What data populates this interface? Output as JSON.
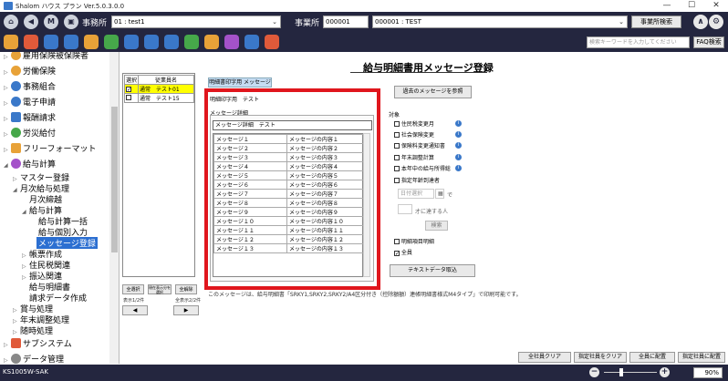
{
  "window": {
    "title": "Shalom ハウス プラン Ver.5.0.3.0.0",
    "min": "—",
    "max": "☐",
    "close": "✕"
  },
  "toolbar1": {
    "office_label": "事務所",
    "office_value": "01 : test1",
    "establishment_label": "事業所",
    "establishment_code": "000001",
    "establishment_value": "000001 : TEST",
    "establishment_search": "事業所検索"
  },
  "toolbar2": {
    "search_placeholder": "検索キーワードを入力してください",
    "faq": "FAQ検索"
  },
  "sidebar": {
    "items": [
      {
        "label": "雇用保険被保険者"
      },
      {
        "label": "労働保険"
      },
      {
        "label": "事務組合"
      },
      {
        "label": "電子申請"
      },
      {
        "label": "報酬請求"
      },
      {
        "label": "労災給付"
      },
      {
        "label": "フリーフォーマット"
      },
      {
        "label": "給与計算"
      },
      {
        "label": "マスター登録"
      },
      {
        "label": "月次給与処理"
      },
      {
        "label": "月次締越"
      },
      {
        "label": "給与計算"
      },
      {
        "label": "給与計算一括"
      },
      {
        "label": "給与個別入力"
      },
      {
        "label": "メッセージ登録"
      },
      {
        "label": "帳票作成"
      },
      {
        "label": "住民税関連"
      },
      {
        "label": "振込関連"
      },
      {
        "label": "給与明細書"
      },
      {
        "label": "請求データ作成"
      },
      {
        "label": "賞与処理"
      },
      {
        "label": "年末調整処理"
      },
      {
        "label": "随時処理"
      },
      {
        "label": "サブシステム"
      },
      {
        "label": "データ管理"
      }
    ]
  },
  "page": {
    "title": "給与明細書用メッセージ登録"
  },
  "employees": {
    "headers": [
      "選択",
      "従業員名"
    ],
    "rows": [
      {
        "checked": "✓",
        "name": "通常　テスト01"
      },
      {
        "checked": "",
        "name": "通常　テスト15"
      }
    ],
    "select_all": "全選択",
    "select_range": "現在表示分を選択",
    "clear_all": "全解除",
    "count_left": "表示1/2件",
    "count_right": "全表示2/2件",
    "prev": "◀",
    "next": "▶"
  },
  "tab": {
    "label": "明細書印字用 メッセージ"
  },
  "form": {
    "print_label": "明細印字用　テスト",
    "detail_label": "メッセージ詳細",
    "detail_value": "メッセージ詳細　テスト",
    "messages": [
      {
        "name": "メッセージ１",
        "content": "メッセージの内容１"
      },
      {
        "name": "メッセージ２",
        "content": "メッセージの内容２"
      },
      {
        "name": "メッセージ３",
        "content": "メッセージの内容３"
      },
      {
        "name": "メッセージ４",
        "content": "メッセージの内容４"
      },
      {
        "name": "メッセージ５",
        "content": "メッセージの内容５"
      },
      {
        "name": "メッセージ６",
        "content": "メッセージの内容６"
      },
      {
        "name": "メッセージ７",
        "content": "メッセージの内容７"
      },
      {
        "name": "メッセージ８",
        "content": "メッセージの内容８"
      },
      {
        "name": "メッセージ９",
        "content": "メッセージの内容９"
      },
      {
        "name": "メッセージ１０",
        "content": "メッセージの内容１０"
      },
      {
        "name": "メッセージ１１",
        "content": "メッセージの内容１１"
      },
      {
        "name": "メッセージ１２",
        "content": "メッセージの内容１２"
      },
      {
        "name": "メッセージ１３",
        "content": "メッセージの内容１３"
      }
    ]
  },
  "right": {
    "past_button": "過去のメッセージを参照",
    "target_label": "対象",
    "targets": [
      {
        "label": "住民税変更月",
        "checked": ""
      },
      {
        "label": "社会保険変更",
        "checked": ""
      },
      {
        "label": "保険料変更通知書",
        "checked": ""
      },
      {
        "label": "年末調整計算",
        "checked": ""
      },
      {
        "label": "本年中の給与所得総",
        "checked": ""
      },
      {
        "label": "指定年齢到達者",
        "checked": ""
      }
    ],
    "date_placeholder": "日付選択",
    "date_suffix": "で",
    "age_placeholder": "才に達する人",
    "search": "検索",
    "detail_print": "明細項目明細",
    "all_label": "全員",
    "all_checked": "✓",
    "text_import": "テキストデータ取込"
  },
  "note": "このメッセージは、給与明細書「SRKY1,SRKY2,SRKY2/A4区分付き（控除額額）連帳明細書様式M4タイプ」で印刷可能です。",
  "bottom": {
    "clear_all": "全社員クリア",
    "clear_selected": "指定社員をクリア",
    "assign_all": "全員に配置",
    "assign_selected": "指定社員に配置"
  },
  "status": {
    "screen_id": "KS1005W-SAK",
    "zoom": "90%",
    "minus": "−",
    "plus": "+"
  },
  "colors": {
    "accent": "#2c6fd1",
    "dark": "#24263f",
    "highlight": "#ffff00",
    "frame": "#e0161d"
  }
}
